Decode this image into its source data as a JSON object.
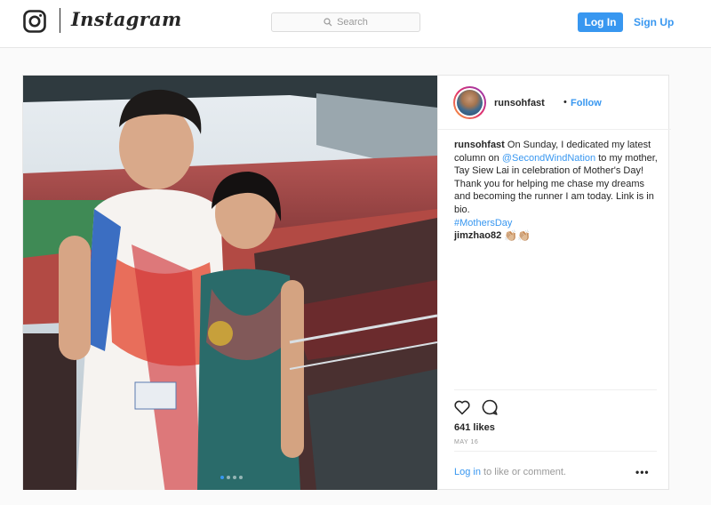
{
  "header": {
    "brand": "Instagram",
    "search_placeholder": "Search",
    "login_label": "Log In",
    "signup_label": "Sign Up"
  },
  "post": {
    "username": "runsohfast",
    "follow_label": "Follow",
    "caption_user": "runsohfast",
    "caption_part1": "On Sunday, I dedicated my latest column on",
    "caption_mention": "@SecondWindNation",
    "caption_part2": "to my mother, Tay Siew Lai in celebration of Mother's Day! Thank you for helping me chase my dreams and becoming the runner I am today. Link is in bio.",
    "caption_hashtag": "#MothersDay",
    "comment_user": "jimzhao82",
    "comment_text": "👏🏼👏🏼",
    "likes": "641 likes",
    "date": "MAY 16",
    "login_link": "Log in",
    "login_suffix": "to like or comment.",
    "more_label": "•••"
  },
  "colors": {
    "accent": "#3897f0",
    "text": "#262626",
    "muted": "#999999",
    "border": "#e6e6e6"
  },
  "icons": [
    "instagram-glyph-icon",
    "search-icon",
    "heart-icon",
    "comment-icon",
    "more-options-icon"
  ]
}
